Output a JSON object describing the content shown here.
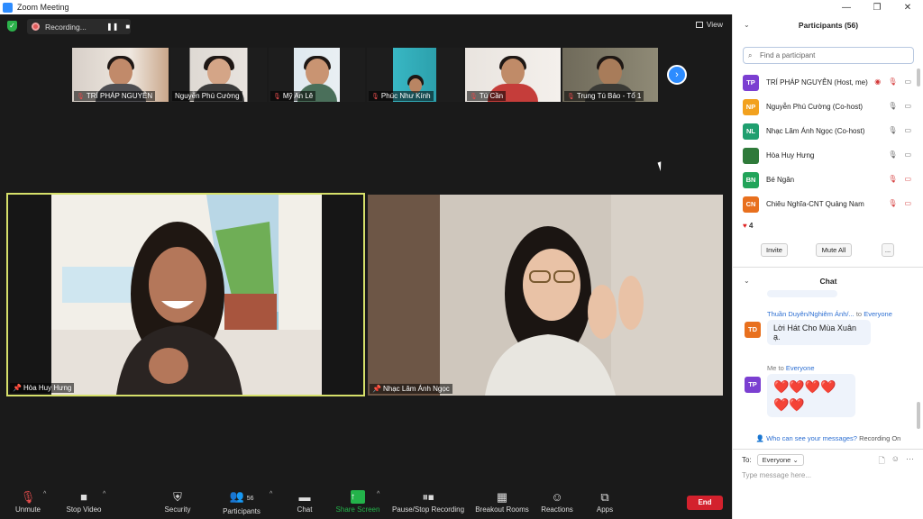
{
  "window": {
    "title": "Zoom Meeting",
    "minimize": "—",
    "maximize": "❐",
    "close": "✕"
  },
  "topbar": {
    "recording_label": "Recording...",
    "pause_icon": "❚❚",
    "stop_icon": "■",
    "view_label": "View"
  },
  "thumbnails": [
    {
      "name": "TRÍ PHÁP NGUYỄN",
      "muted": true
    },
    {
      "name": "Nguyễn Phú Cường",
      "muted": false
    },
    {
      "name": "Mỹ An Lê",
      "muted": true
    },
    {
      "name": "Phúc Như Kính",
      "muted": true
    },
    {
      "name": "Tú Cần",
      "muted": true
    },
    {
      "name": "Trung Tú Bảo - Tổ 1",
      "muted": true
    }
  ],
  "main_videos": [
    {
      "name": "Hòa Huy Hưng",
      "active_speaker": true
    },
    {
      "name": "Nhạc Lâm Ánh Ngọc",
      "active_speaker": false
    }
  ],
  "toolbar": {
    "unmute": "Unmute",
    "stop_video": "Stop Video",
    "security": "Security",
    "participants": "Participants",
    "participants_count": "56",
    "chat": "Chat",
    "share_screen": "Share Screen",
    "recording": "Pause/Stop Recording",
    "breakout": "Breakout Rooms",
    "reactions": "Reactions",
    "apps": "Apps",
    "end": "End"
  },
  "participants_panel": {
    "title": "Participants (56)",
    "search_placeholder": "Find a participant",
    "list": [
      {
        "initials": "TP",
        "name": "TRÍ PHÁP NGUYỄN (Host, me)",
        "color": "#7b3fd1"
      },
      {
        "initials": "NP",
        "name": "Nguyễn Phú Cường (Co-host)",
        "color": "#f2a11e"
      },
      {
        "initials": "NL",
        "name": "Nhạc Lâm Ánh Ngọc (Co-host)",
        "color": "#1f9f6f"
      },
      {
        "initials": "",
        "name": "Hòa Huy Hưng",
        "color": "#2f7a3a"
      },
      {
        "initials": "BN",
        "name": "Bé Ngân",
        "color": "#22a45a"
      },
      {
        "initials": "CN",
        "name": "Chiêu Nghĩa-CNT Quảng Nam",
        "color": "#e8701e"
      }
    ],
    "reaction_count": "4",
    "invite": "Invite",
    "mute_all": "Mute All",
    "more": "..."
  },
  "chat_panel": {
    "title": "Chat",
    "messages": [
      {
        "from": "Thuần Duyên/Nghiêm Ánh/...",
        "to_prefix": "to",
        "to": "Everyone",
        "initials": "TD",
        "avatar_color": "#e8701e",
        "text": "Lời Hát Cho Mùa Xuân ạ."
      },
      {
        "from": "Me",
        "to_prefix": "to",
        "to": "Everyone",
        "initials": "TP",
        "avatar_color": "#7b3fd1",
        "text": "❤️❤️❤️❤️❤️❤️"
      }
    ],
    "privacy_text": "Who can see your messages?",
    "privacy_recording": "Recording On",
    "to_label": "To:",
    "to_value": "Everyone",
    "input_placeholder": "Type message here..."
  }
}
